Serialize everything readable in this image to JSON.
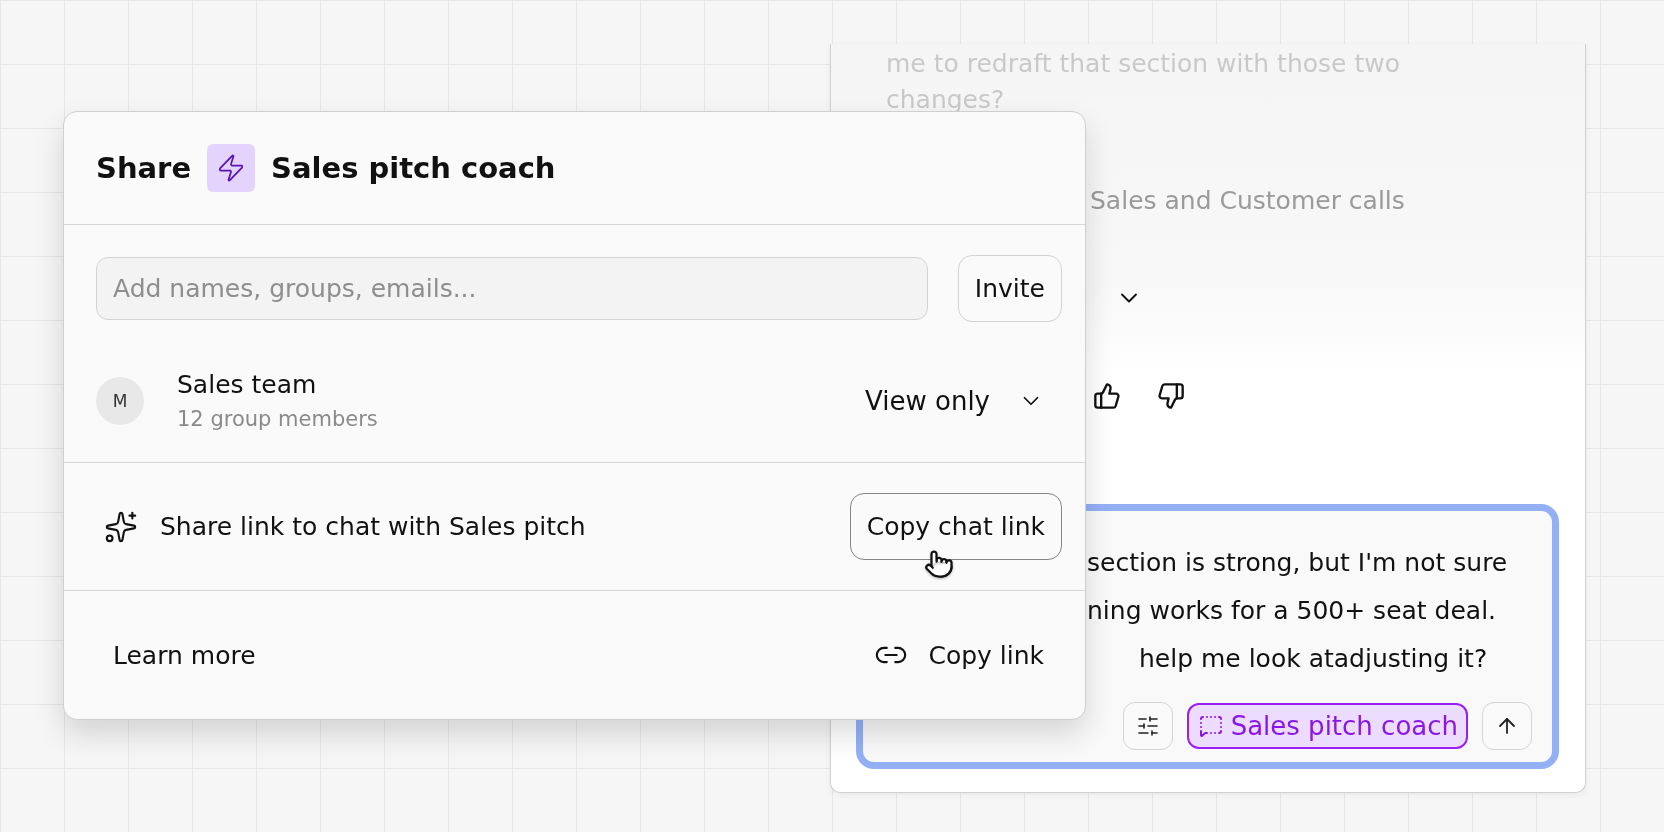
{
  "chat": {
    "faded_lines": [
      "me to redraft that section with those two",
      "changes?"
    ],
    "source_label": "Sales and Customer calls",
    "feedback": {
      "liked": false,
      "disliked": false
    },
    "composer": {
      "lines": [
        "section is strong, but I'm not sure",
        "ning works for a 500+ seat deal.",
        "help me look atadjusting it?"
      ],
      "agent_chip": "Sales pitch coach"
    }
  },
  "share_dialog": {
    "title_prefix": "Share",
    "title": "Sales pitch coach",
    "invite": {
      "placeholder": "Add names, groups, emails...",
      "button": "Invite"
    },
    "members": [
      {
        "initial": "M",
        "name": "Sales team",
        "detail": "12 group members",
        "role": "View only"
      }
    ],
    "chat_link": {
      "text": "Share link to chat with Sales pitch",
      "button": "Copy chat link"
    },
    "footer": {
      "learn_more": "Learn more",
      "copy_link": "Copy link"
    }
  }
}
